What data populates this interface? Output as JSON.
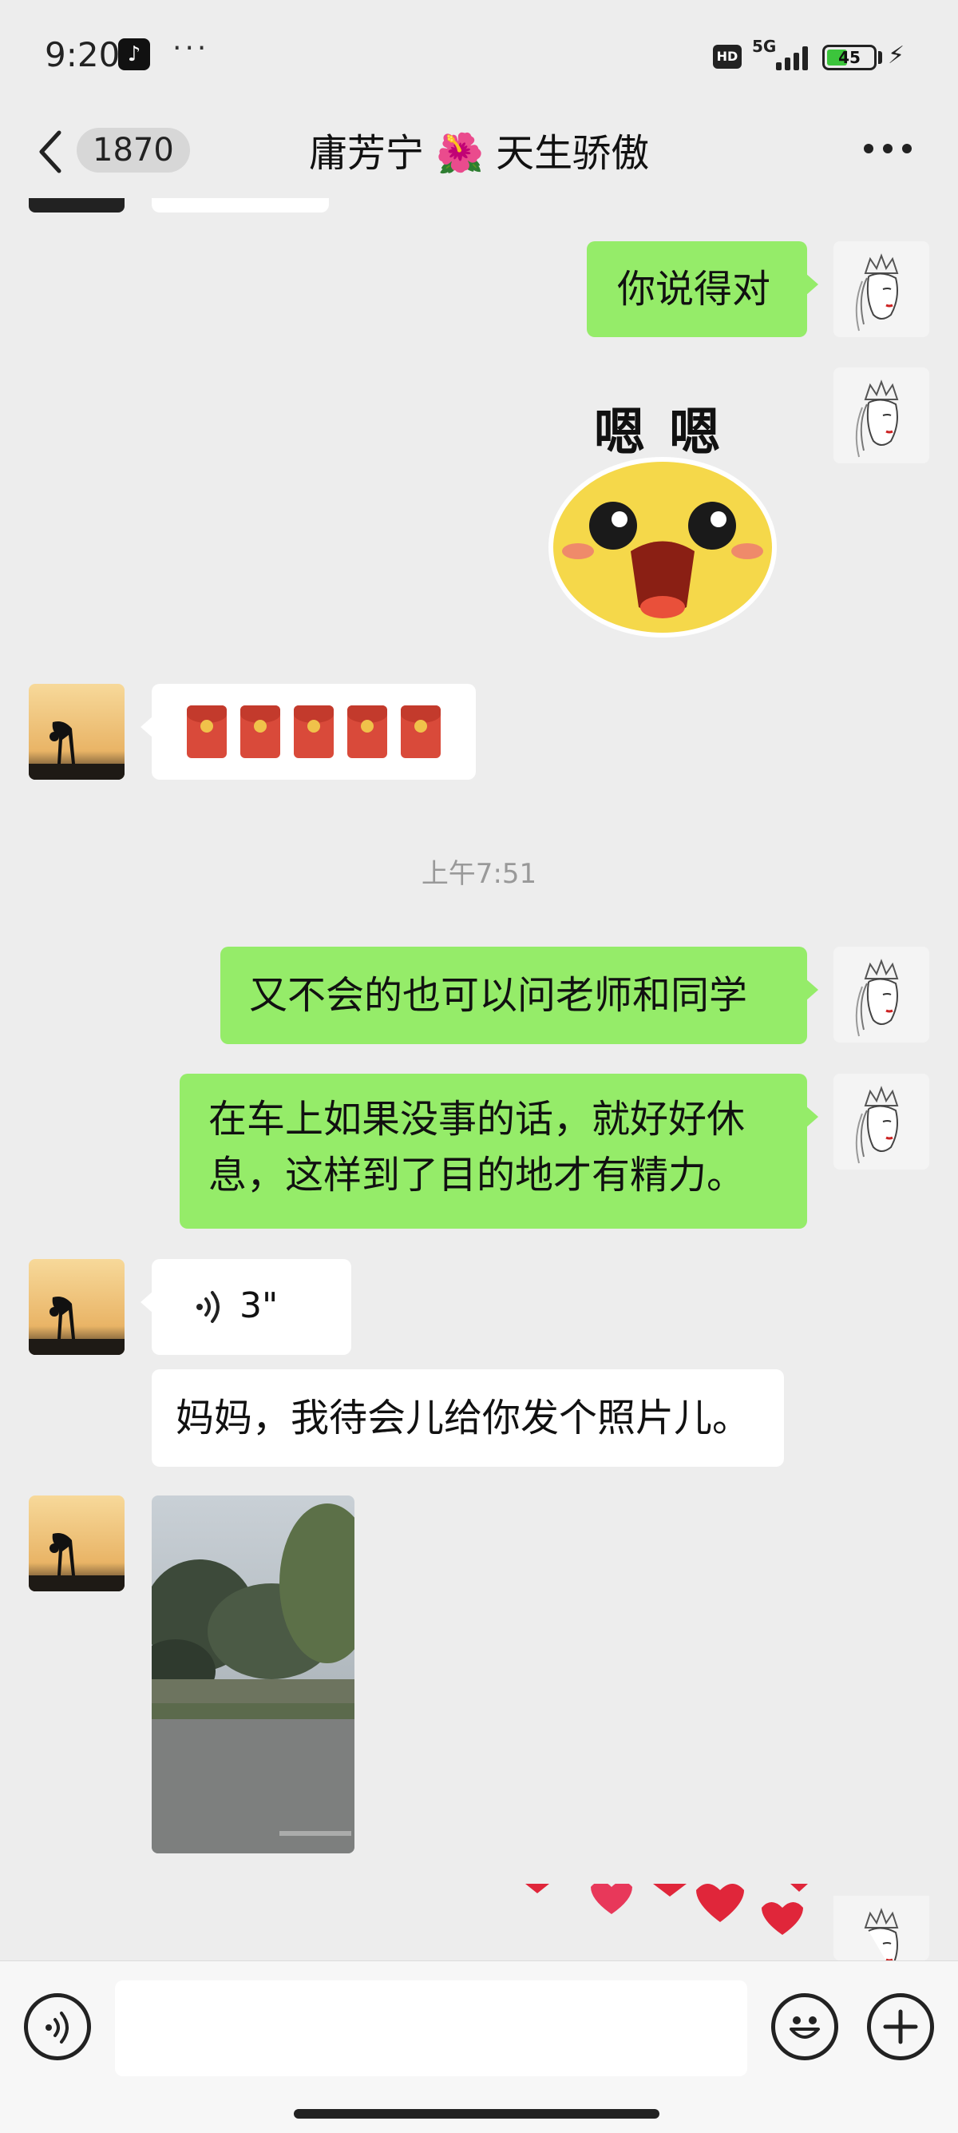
{
  "status_bar": {
    "time": "9:20",
    "more": "···",
    "hd": "HD",
    "network": "5G",
    "battery": "45",
    "battery_level": 0.45
  },
  "nav": {
    "unread_count": "1870",
    "title": "庸芳宁 🌺 天生骄傲"
  },
  "messages": {
    "m1": "你说得对",
    "sticker_text": "嗯 嗯",
    "timestamp": "上午7:51",
    "m2": "又不会的也可以问老师和同学",
    "m3_line1": "在车上如果没事的话，就好好休",
    "m3_line2": "息，这样到了目的地才有精力。",
    "voice_duration": "3\"",
    "m4": "妈妈，我待会儿给你发个照片儿。"
  },
  "input": {
    "placeholder": ""
  },
  "colors": {
    "my_bubble": "#95ec69",
    "their_bubble": "#ffffff",
    "background": "#ededed"
  }
}
